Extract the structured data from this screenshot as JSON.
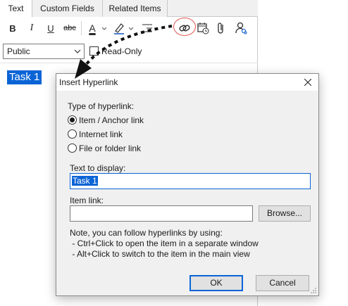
{
  "editor": {
    "tabs": [
      {
        "label": "Text",
        "active": true
      },
      {
        "label": "Custom Fields",
        "active": false
      },
      {
        "label": "Related Items",
        "active": false
      }
    ],
    "toolbar": {
      "bold": "B",
      "italic": "I",
      "underline": "U",
      "strike": "abc",
      "font_color": "A"
    },
    "visibility_select": "Public",
    "readonly_label": "Read-Only",
    "task_title": "Task 1"
  },
  "dialog": {
    "title": "Insert Hyperlink",
    "type_label": "Type of hyperlink:",
    "link_types": [
      {
        "label": "Item / Anchor link",
        "checked": true
      },
      {
        "label": "Internet link",
        "checked": false
      },
      {
        "label": "File or folder link",
        "checked": false
      }
    ],
    "display_label": "Text to display:",
    "display_value": "Task 1",
    "item_link_label": "Item link:",
    "item_link_value": "",
    "browse_label": "Browse...",
    "note_lines": [
      "Note, you can follow hyperlinks by using:",
      " - Ctrl+Click to open the item in a separate window",
      " - Alt+Click to switch to the item in the main view"
    ],
    "ok_label": "OK",
    "cancel_label": "Cancel"
  },
  "colors": {
    "selection": "#0a64d6",
    "highlight_circle": "#e0574f",
    "arrow": "#111111"
  }
}
